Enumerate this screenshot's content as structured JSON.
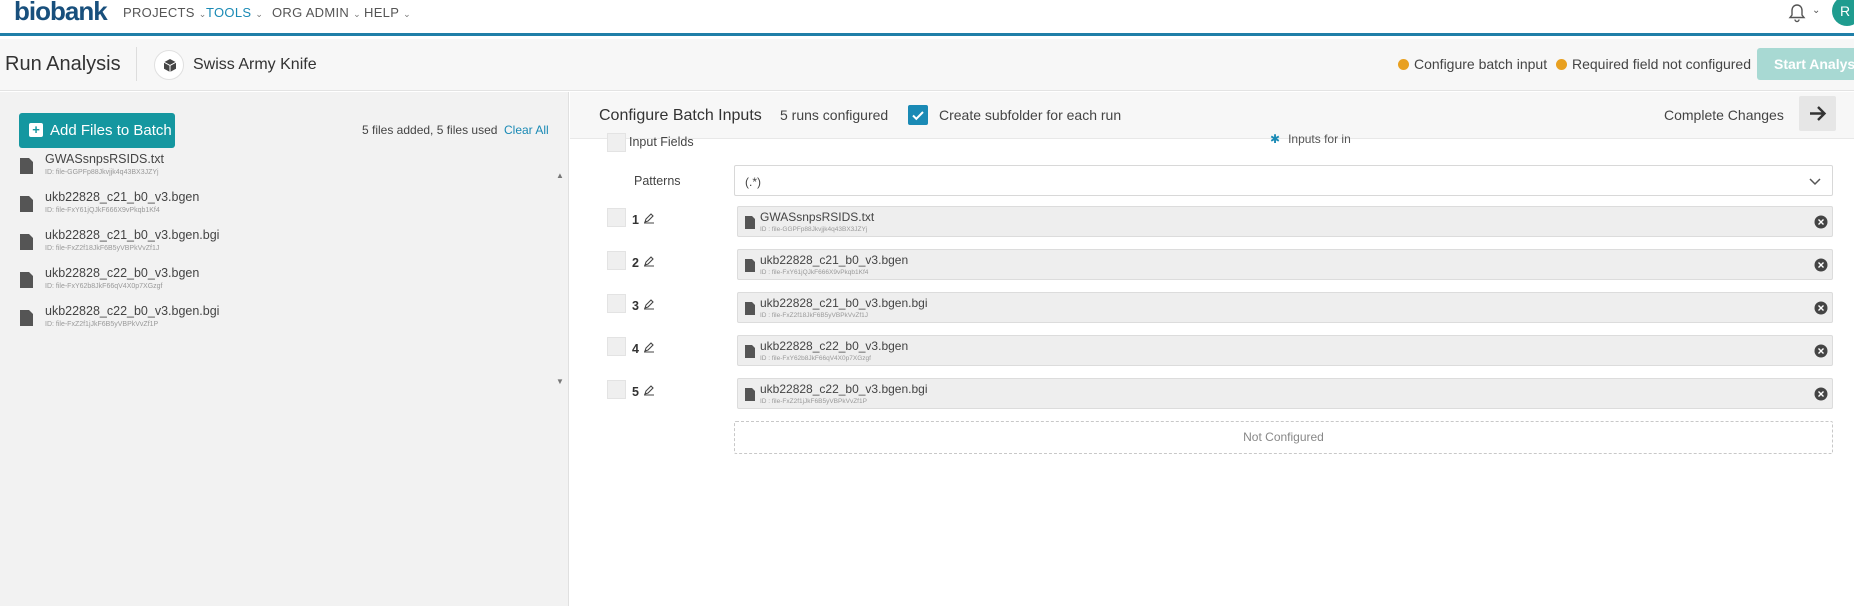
{
  "nav": {
    "logo": "biobank",
    "items": [
      {
        "label": "PROJECTS"
      },
      {
        "label": "TOOLS"
      },
      {
        "label": "ORG ADMIN"
      },
      {
        "label": "HELP"
      }
    ],
    "avatar_initial": "R"
  },
  "header": {
    "title": "Run Analysis",
    "app_name": "Swiss Army Knife",
    "status_configure": "Configure batch input",
    "status_required": "Required field not configured",
    "start_button": "Start Analysis",
    "status_color": "#e8a020"
  },
  "left": {
    "add_button": "Add Files to Batch",
    "file_count": "5 files added, 5 files used",
    "clear_all": "Clear All",
    "files": [
      {
        "name": "GWASsnpsRSIDS.txt",
        "id": "ID: file-GGPFp88Jkvjjk4q43BX3JZYj"
      },
      {
        "name": "ukb22828_c21_b0_v3.bgen",
        "id": "ID: file-FxY61jQJkF666X9vPkqb1Kf4"
      },
      {
        "name": "ukb22828_c21_b0_v3.bgen.bgi",
        "id": "ID: file-FxZ2f18JkF6B5yVBPkVvZf1J"
      },
      {
        "name": "ukb22828_c22_b0_v3.bgen",
        "id": "ID: file-FxY62b8JkF66qV4X0p7XGzgf"
      },
      {
        "name": "ukb22828_c22_b0_v3.bgen.bgi",
        "id": "ID: file-FxZ2f1jJkF6B5yVBPkVvZf1P"
      }
    ]
  },
  "config": {
    "title": "Configure Batch Inputs",
    "runs": "5 runs configured",
    "subfolder_label": "Create subfolder for each run",
    "subfolder_checked": true,
    "complete_changes": "Complete Changes",
    "input_fields": "Input Fields",
    "inputs_for": "Inputs for in",
    "patterns_label": "Patterns",
    "pattern_value": "(.*)",
    "rows": [
      {
        "num": "1",
        "name": "GWASsnpsRSIDS.txt",
        "id": "ID : file-GGPFp88Jkvjjk4q43BX3JZYj"
      },
      {
        "num": "2",
        "name": "ukb22828_c21_b0_v3.bgen",
        "id": "ID : file-FxY61jQJkF666X9vPkqb1Kf4"
      },
      {
        "num": "3",
        "name": "ukb22828_c21_b0_v3.bgen.bgi",
        "id": "ID : file-FxZ2f18JkF6B5yVBPkVvZf1J"
      },
      {
        "num": "4",
        "name": "ukb22828_c22_b0_v3.bgen",
        "id": "ID : file-FxY62b8JkF66qV4X0p7XGzgf"
      },
      {
        "num": "5",
        "name": "ukb22828_c22_b0_v3.bgen.bgi",
        "id": "ID : file-FxZ2f1jJkF6B5yVBPkVvZf1P"
      }
    ],
    "not_configured": "Not Configured"
  },
  "colors": {
    "accent": "#1a8ab5",
    "teal_button": "#1597a0",
    "start_disabled": "#a8d9d3"
  }
}
